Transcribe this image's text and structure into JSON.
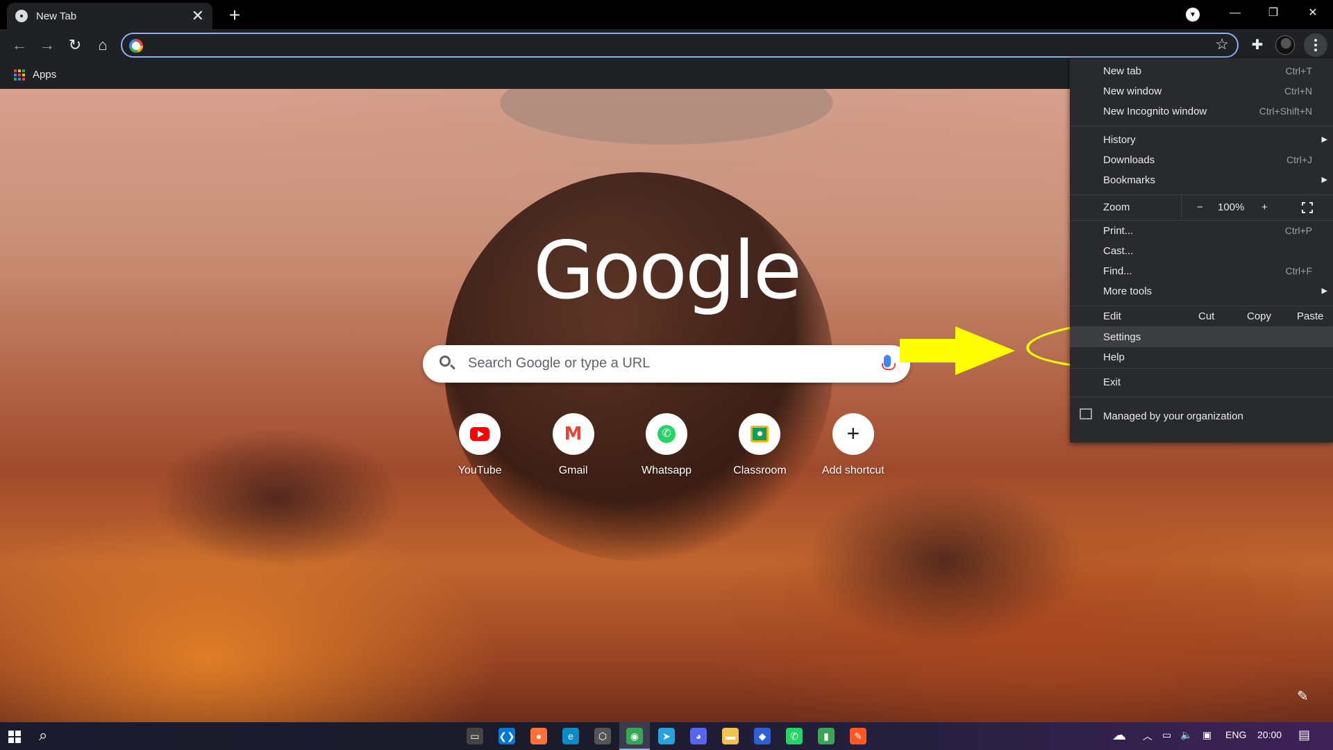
{
  "tab": {
    "title": "New Tab",
    "close": "✕"
  },
  "newtab": "+",
  "window_controls": {
    "minimize": "—",
    "maximize": "❐",
    "close": "✕"
  },
  "toolbar": {
    "back": "←",
    "forward": "→",
    "reload": "↻",
    "home": "⌂",
    "star": "☆",
    "extensions": "✚"
  },
  "bookmarks": {
    "apps_label": "Apps",
    "apps_colors": [
      "#ea4335",
      "#fbbc05",
      "#34a853",
      "#4285f4",
      "#ea4335",
      "#fbbc05",
      "#34a853",
      "#4285f4",
      "#ea4335"
    ]
  },
  "ntp": {
    "logo": "Google",
    "search_placeholder": "Search Google or type a URL",
    "shortcuts": [
      {
        "label": "YouTube",
        "icon": "youtube-icon"
      },
      {
        "label": "Gmail",
        "icon": "gmail-icon",
        "glyph": "M"
      },
      {
        "label": "Whatsapp",
        "icon": "whatsapp-icon",
        "glyph": "✆"
      },
      {
        "label": "Classroom",
        "icon": "classroom-icon"
      },
      {
        "label": "Add shortcut",
        "icon": "plus-icon",
        "glyph": "+"
      }
    ],
    "customize": "✎"
  },
  "menu": {
    "new_tab": {
      "label": "New tab",
      "shortcut": "Ctrl+T"
    },
    "new_window": {
      "label": "New window",
      "shortcut": "Ctrl+N"
    },
    "incognito": {
      "label": "New Incognito window",
      "shortcut": "Ctrl+Shift+N"
    },
    "history": {
      "label": "History"
    },
    "downloads": {
      "label": "Downloads",
      "shortcut": "Ctrl+J"
    },
    "bookmarks": {
      "label": "Bookmarks"
    },
    "zoom": {
      "label": "Zoom",
      "minus": "−",
      "value": "100%",
      "plus": "+"
    },
    "print": {
      "label": "Print...",
      "shortcut": "Ctrl+P"
    },
    "cast": {
      "label": "Cast..."
    },
    "find": {
      "label": "Find...",
      "shortcut": "Ctrl+F"
    },
    "more_tools": {
      "label": "More tools"
    },
    "edit": {
      "label": "Edit",
      "cut": "Cut",
      "copy": "Copy",
      "paste": "Paste"
    },
    "settings": {
      "label": "Settings"
    },
    "help": {
      "label": "Help"
    },
    "exit": {
      "label": "Exit"
    },
    "managed": {
      "label": "Managed by your organization"
    },
    "submenu_arrow": "▶"
  },
  "annotation": {
    "color": "#ffff00"
  },
  "taskbar": {
    "apps": [
      {
        "name": "terminal-icon",
        "glyph": "▭",
        "color": "#444"
      },
      {
        "name": "vscode-icon",
        "glyph": "❮❯",
        "color": "#0078d4"
      },
      {
        "name": "firefox-icon",
        "glyph": "●",
        "color": "#ff7139"
      },
      {
        "name": "edge-icon",
        "glyph": "e",
        "color": "#0c8ac6"
      },
      {
        "name": "settings-app-icon",
        "glyph": "⬡",
        "color": "#555"
      },
      {
        "name": "chrome-icon",
        "glyph": "◉",
        "color": "#34a853"
      },
      {
        "name": "telegram-icon",
        "glyph": "➤",
        "color": "#2aa1da"
      },
      {
        "name": "discord-icon",
        "glyph": "◕",
        "color": "#5865f2"
      },
      {
        "name": "file-explorer-icon",
        "glyph": "▬",
        "color": "#f2c14e"
      },
      {
        "name": "app-blue-icon",
        "glyph": "◆",
        "color": "#2d5fd6"
      },
      {
        "name": "whatsapp-taskbar-icon",
        "glyph": "✆",
        "color": "#25d366"
      },
      {
        "name": "app-green-icon",
        "glyph": "▮",
        "color": "#3aa655"
      },
      {
        "name": "app-orange-icon",
        "glyph": "✎",
        "color": "#ff5722"
      }
    ],
    "search": "⌕",
    "tray": {
      "weather": "☁",
      "chevron": "︿",
      "battery": "▭",
      "volume": "🔈",
      "network": "▣",
      "lang": "ENG",
      "time": "20:00",
      "notifications": "▤"
    }
  }
}
